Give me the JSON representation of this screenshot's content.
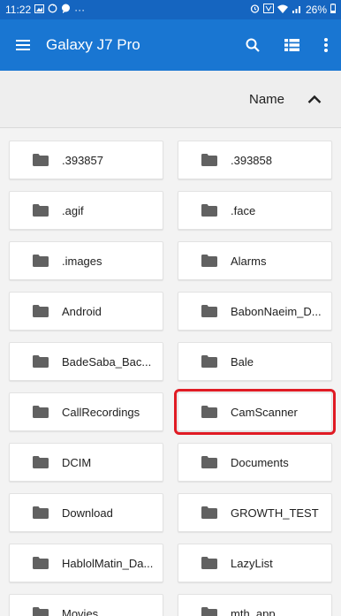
{
  "status_bar": {
    "time": "11:22",
    "left_icons": [
      "image-icon",
      "sync-icon",
      "chat-icon"
    ],
    "more": "···",
    "battery": "26%"
  },
  "app_bar": {
    "title": "Galaxy J7 Pro",
    "color": "#1976d2"
  },
  "sort_bar": {
    "label": "Name"
  },
  "folders": [
    {
      "name": ".393857"
    },
    {
      "name": ".393858"
    },
    {
      "name": ".agif"
    },
    {
      "name": ".face"
    },
    {
      "name": ".images"
    },
    {
      "name": "Alarms"
    },
    {
      "name": "Android"
    },
    {
      "name": "BabonNaeim_D..."
    },
    {
      "name": "BadeSaba_Bac..."
    },
    {
      "name": "Bale"
    },
    {
      "name": "CallRecordings"
    },
    {
      "name": "CamScanner",
      "highlighted": true
    },
    {
      "name": "DCIM"
    },
    {
      "name": "Documents"
    },
    {
      "name": "Download"
    },
    {
      "name": "GROWTH_TEST"
    },
    {
      "name": "HablolMatin_Da..."
    },
    {
      "name": "LazyList"
    },
    {
      "name": "Movies"
    },
    {
      "name": "mth_app"
    }
  ],
  "highlight_color": "#e01b24"
}
